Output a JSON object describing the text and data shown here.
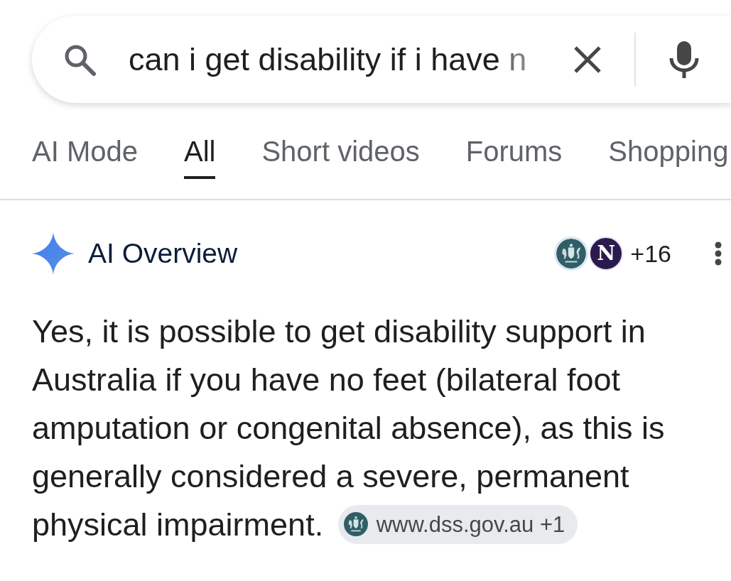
{
  "search": {
    "query": "can i get disability if i have n"
  },
  "tabs": [
    {
      "label": "AI Mode",
      "selected": false
    },
    {
      "label": "All",
      "selected": true
    },
    {
      "label": "Short videos",
      "selected": false
    },
    {
      "label": "Forums",
      "selected": false
    },
    {
      "label": "Shopping",
      "selected": false
    }
  ],
  "overview": {
    "title": "AI Overview",
    "sources": [
      {
        "kind": "emblem"
      },
      {
        "kind": "letter",
        "text": "N"
      }
    ],
    "source_count": "+16",
    "answer": "Yes, it is possible to get disability support in Australia if you have no feet (bilateral foot amputation or congenital absence), as this is generally considered a severe, permanent physical impairment.",
    "citation": {
      "label": "www.dss.gov.au +1"
    }
  }
}
